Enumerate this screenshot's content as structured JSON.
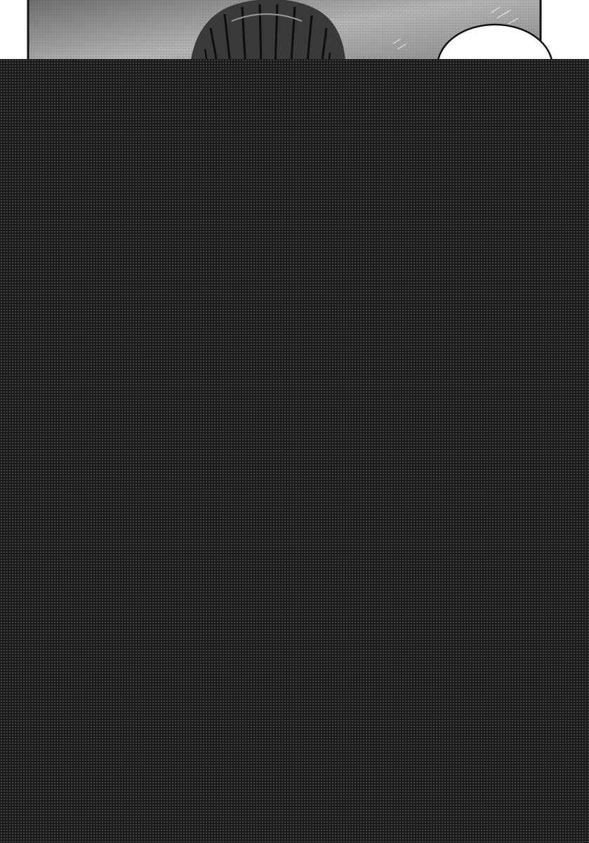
{
  "page": {
    "colors": {
      "paper": "#ffffff",
      "ink": "#111111",
      "mask": "#1b1b1b"
    }
  }
}
